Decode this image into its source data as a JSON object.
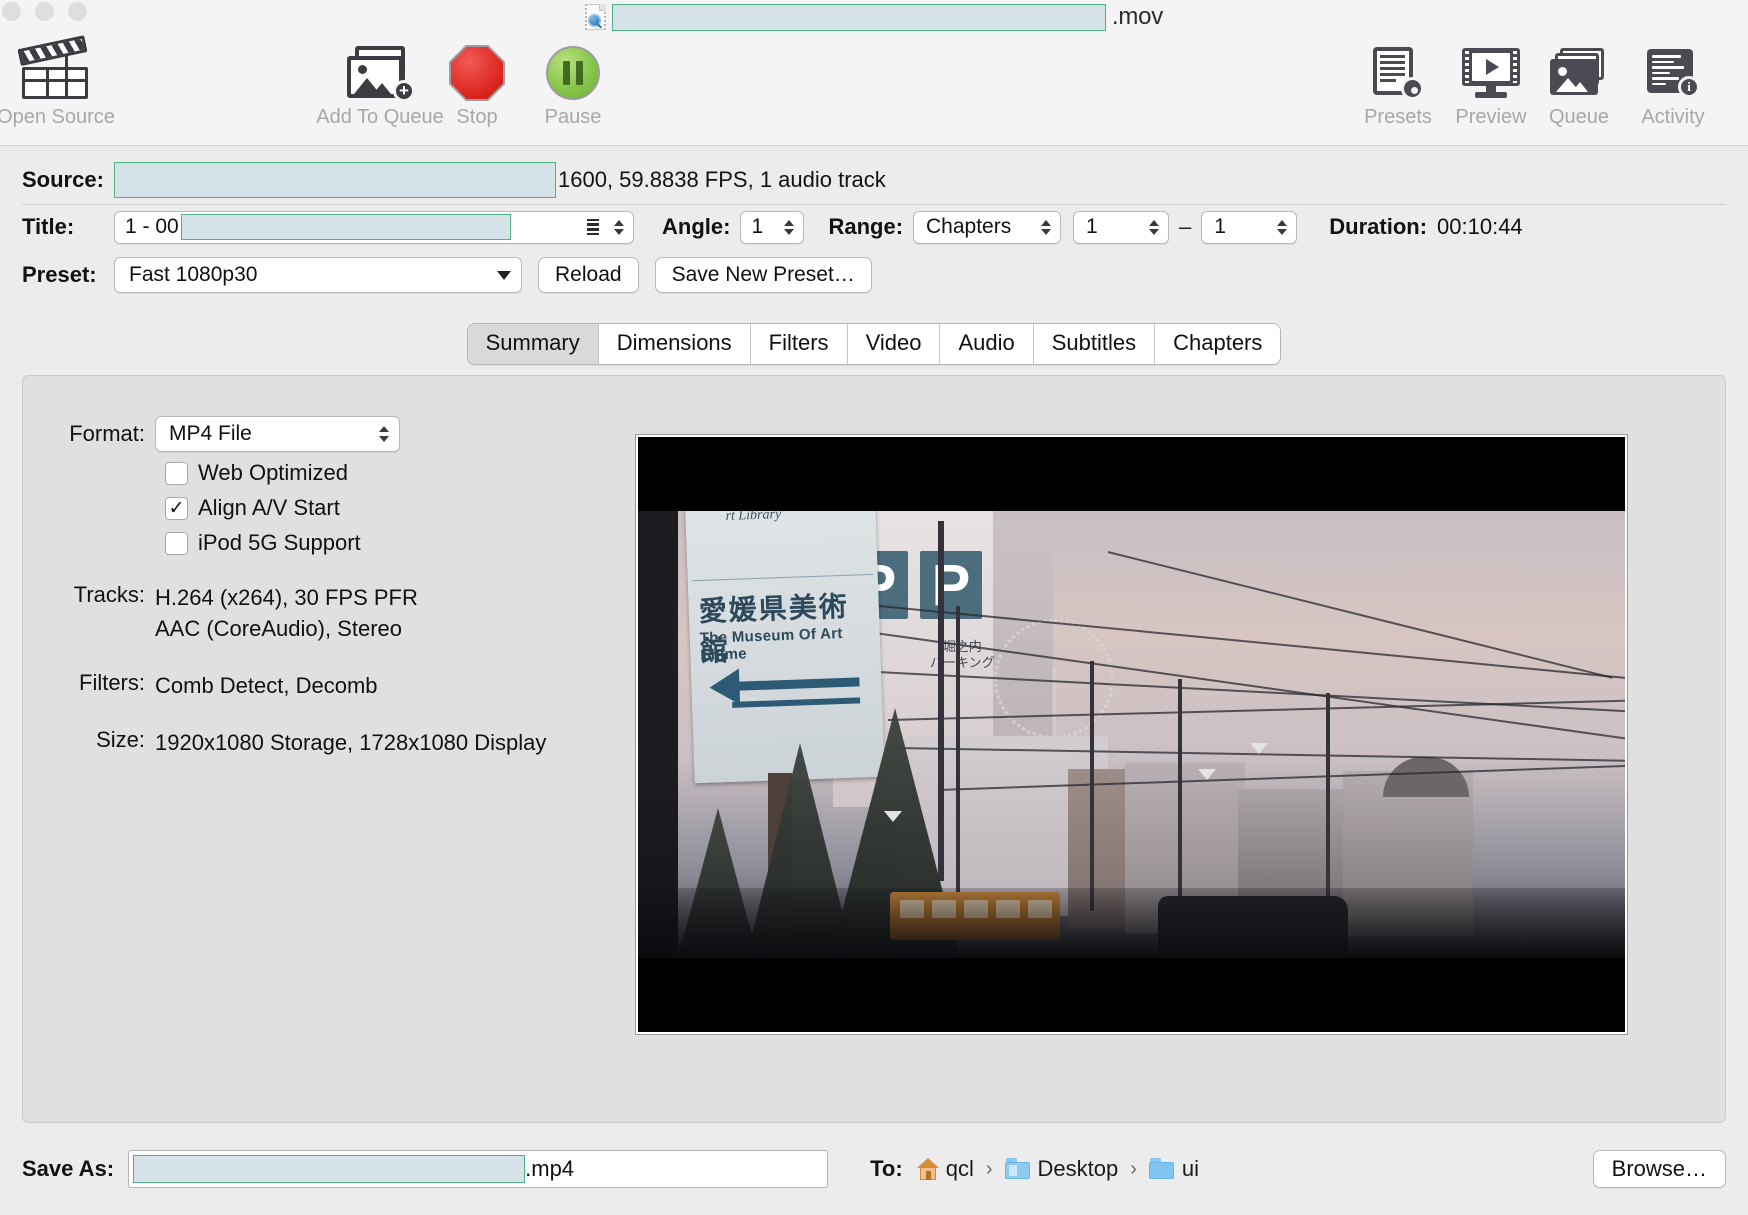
{
  "window": {
    "title_suffix": ".mov",
    "title_redacted": true,
    "traffic_lights": [
      "close",
      "minimize",
      "zoom"
    ],
    "doc_icon": "quicktime-movie-icon"
  },
  "toolbar": {
    "items": [
      {
        "label": "Open Source",
        "icon": "clapperboard-icon",
        "enabled": true
      },
      {
        "label": "Add To Queue",
        "icon": "add-to-queue-icon",
        "enabled": false
      },
      {
        "label": "Stop",
        "icon": "stop-octagon-icon",
        "enabled": false
      },
      {
        "label": "Pause",
        "icon": "pause-circle-icon",
        "enabled": false
      },
      {
        "label": "Presets",
        "icon": "presets-gear-icon",
        "enabled": true
      },
      {
        "label": "Preview",
        "icon": "preview-monitor-icon",
        "enabled": true
      },
      {
        "label": "Queue",
        "icon": "queue-stack-icon",
        "enabled": true
      },
      {
        "label": "Activity",
        "icon": "activity-log-icon",
        "enabled": true
      }
    ]
  },
  "source": {
    "label": "Source:",
    "path_redacted": true,
    "meta": "1600, 59.8838 FPS, 1 audio track"
  },
  "title_row": {
    "label": "Title:",
    "value_prefix": "1 - 00",
    "value_redacted": true,
    "angle_label": "Angle:",
    "angle_value": "1",
    "range_label": "Range:",
    "range_type": "Chapters",
    "range_start": "1",
    "range_dash": "–",
    "range_end": "1",
    "duration_label": "Duration:",
    "duration_value": "00:10:44"
  },
  "preset_row": {
    "label": "Preset:",
    "value": "Fast 1080p30",
    "reload_label": "Reload",
    "save_preset_label": "Save New Preset…"
  },
  "tabs": {
    "active": "Summary",
    "items": [
      "Summary",
      "Dimensions",
      "Filters",
      "Video",
      "Audio",
      "Subtitles",
      "Chapters"
    ]
  },
  "summary": {
    "format_label": "Format:",
    "format_value": "MP4 File",
    "checkboxes": [
      {
        "label": "Web Optimized",
        "checked": false
      },
      {
        "label": "Align A/V Start",
        "checked": true
      },
      {
        "label": "iPod 5G Support",
        "checked": false
      }
    ],
    "tracks_label": "Tracks:",
    "tracks_lines": [
      "H.264 (x264), 30 FPS PFR",
      "AAC (CoreAudio), Stereo"
    ],
    "filters_label": "Filters:",
    "filters_value": "Comb Detect, Decomb",
    "size_label": "Size:",
    "size_value": "1920x1080 Storage, 1728x1080 Display"
  },
  "preview": {
    "alt": "video-preview-still",
    "sign_library": "rt Library",
    "sign_jp": "愛媛県美術館",
    "sign_en": "The Museum Of Art Ehime",
    "parking_letters": [
      "P",
      "P"
    ],
    "parking_jp": "堀之内\nパーキング"
  },
  "bottom": {
    "save_as_label": "Save As:",
    "save_as_redacted": true,
    "save_as_suffix": ".mp4",
    "to_label": "To:",
    "breadcrumbs": [
      {
        "label": "qcl",
        "icon": "home-icon"
      },
      {
        "label": "Desktop",
        "icon": "folder-icon"
      },
      {
        "label": "ui",
        "icon": "folder-icon"
      }
    ],
    "separator": "›",
    "browse_label": "Browse…"
  },
  "colors": {
    "window_bg": "#ececec",
    "toolbar_bg": "#f4f4f4",
    "panel_bg": "#e0e0e0",
    "redaction_fill": "#d5e3e8",
    "redaction_border": "#4cb286",
    "stop_red": "#e02a24",
    "pause_green": "#86c64a",
    "folder_blue": "#7fc4ef"
  }
}
